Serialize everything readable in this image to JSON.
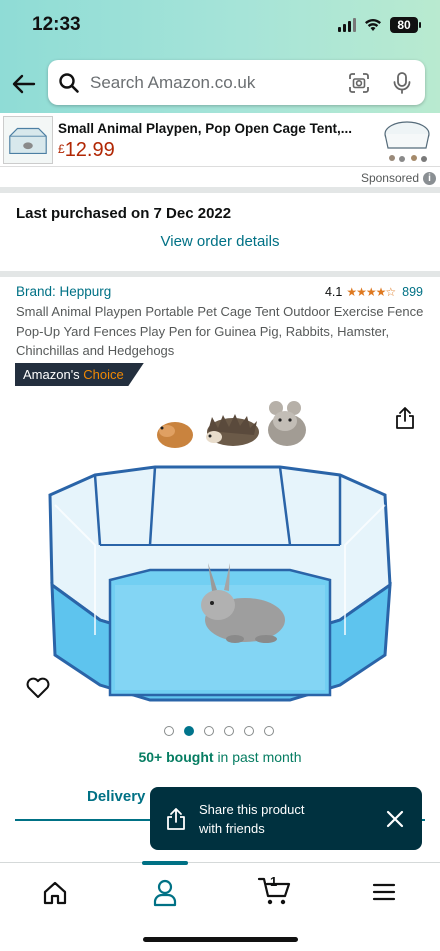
{
  "status_bar": {
    "time": "12:33",
    "battery": "80"
  },
  "search": {
    "placeholder": "Search Amazon.co.uk"
  },
  "sponsored_banner": {
    "title": "Small Animal Playpen, Pop Open Cage Tent,...",
    "currency": "£",
    "price": "12.99",
    "sponsored_label": "Sponsored",
    "info_glyph": "i"
  },
  "order": {
    "last_purchased": "Last purchased on 7 Dec 2022",
    "view_details": "View order details"
  },
  "product": {
    "brand": "Brand: Heppurg",
    "rating": "4.1",
    "stars": "★★★★☆",
    "rating_count": "899",
    "title": "Small Animal Playpen Portable Pet Cage Tent Outdoor Exercise Fence Pop-Up Yard Fences Play Pen for Guinea Pig, Rabbits, Hamster, Chinchillas and Hedgehogs",
    "badge_prefix": "Amazon's",
    "badge_accent": "Choice",
    "image_count": 6,
    "active_image": 2,
    "bought_bold": "50+ bought",
    "bought_rest": "in past month"
  },
  "tabs": {
    "delivery": "Delivery"
  },
  "toast": {
    "line1": "Share this product",
    "line2": "with friends"
  },
  "bottom_nav": {
    "cart_count": "1"
  },
  "colors": {
    "link": "#007185",
    "price": "#b12704",
    "badge_bg": "#232f3e",
    "badge_accent": "#f08804",
    "bought_green": "#067d62",
    "toast_bg": "#00313f",
    "stars": "#de7921"
  },
  "icons": [
    "back-arrow-icon",
    "search-icon",
    "camera-icon",
    "mic-icon",
    "info-icon",
    "share-icon",
    "heart-icon",
    "home-icon",
    "account-icon",
    "cart-icon",
    "menu-icon",
    "close-icon"
  ]
}
